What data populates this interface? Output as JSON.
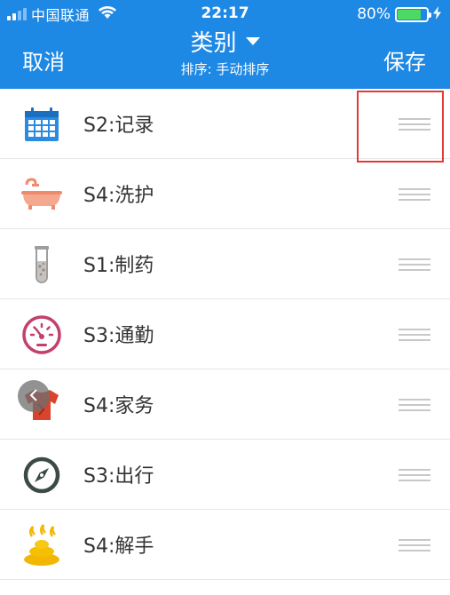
{
  "status_bar": {
    "carrier": "中国联通",
    "time": "22:17",
    "battery": "80%",
    "battery_level": 0.8
  },
  "nav": {
    "cancel_label": "取消",
    "title": "类别",
    "subtitle": "排序: 手动排序",
    "save_label": "保存"
  },
  "items": [
    {
      "label": "S2:记录",
      "icon": "calendar-icon"
    },
    {
      "label": "S4:洗护",
      "icon": "bathtub-icon"
    },
    {
      "label": "S1:制药",
      "icon": "test-tube-icon"
    },
    {
      "label": "S3:通勤",
      "icon": "speedometer-icon"
    },
    {
      "label": "S4:家务",
      "icon": "shirt-icon"
    },
    {
      "label": "S3:出行",
      "icon": "compass-icon"
    },
    {
      "label": "S4:解手",
      "icon": "poop-icon"
    }
  ],
  "colors": {
    "header": "#1e88e5",
    "highlight": "#e53935"
  }
}
